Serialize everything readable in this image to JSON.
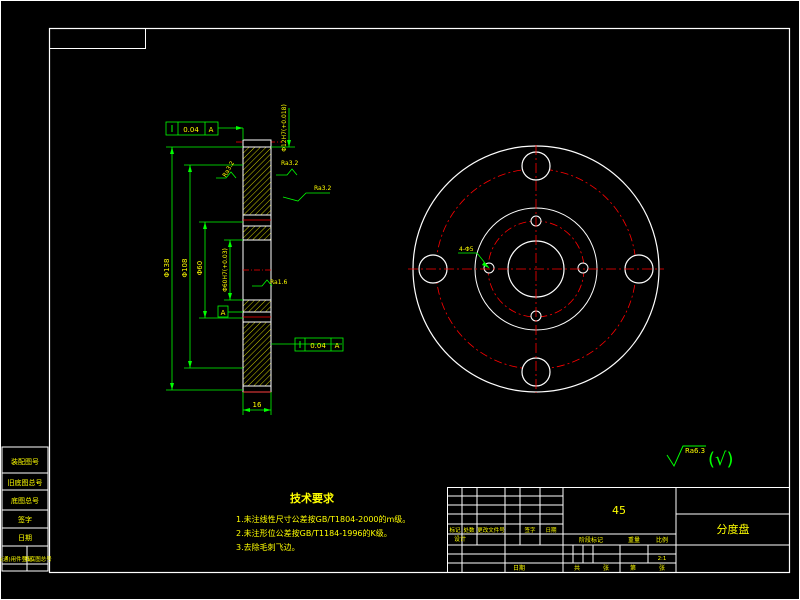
{
  "drawing": {
    "section_view": {
      "dim_outer_dia": "Φ138",
      "dim_mid_dia": "Φ108",
      "dim_inner_dia": "Φ60",
      "dim_bore_tol": "Φ60H7(+0.03)",
      "dim_top_tol": "Φ12H7(+0.018)",
      "dim_width": "16",
      "gdt_top_value": "0.04",
      "gdt_top_datum": "A",
      "gdt_bottom_value": "0.04",
      "gdt_bottom_datum": "A",
      "datum_label": "A",
      "rough_top_left": "Ra3.2",
      "rough_top_right": "Ra3.2",
      "rough_face": "Ra3.2",
      "rough_mid": "Ra1.6"
    },
    "front_view": {
      "hole_label": "4-Φ5"
    },
    "general_roughness": {
      "value": "Ra6.3",
      "suffix": "(√)"
    },
    "tech_requirements": {
      "title": "技术要求",
      "items": [
        "1.未注线性尺寸公差按GB/T1804-2000的m级。",
        "2.未注形位公差按GB/T1184-1996的K级。",
        "3.去除毛刺飞边。"
      ]
    },
    "left_strip": [
      "装配图号",
      "旧底图总号",
      "底图总号",
      "签字",
      "日期"
    ],
    "left_strip_bottom": [
      "借(通)用件登记",
      "旧底图总号"
    ],
    "title_block": {
      "material": "45",
      "part_name": "分度盘",
      "scale": "2:1",
      "row_labels": [
        "标记",
        "处数",
        "更改文件号",
        "签字",
        "日期"
      ],
      "row_designer": "设计",
      "stage_labels": [
        "阶段标记",
        "重量",
        "比例"
      ],
      "bottom_labels": [
        "共",
        "张",
        "第",
        "张"
      ],
      "date_label": "日期"
    }
  },
  "colors": {
    "frame": "#ffffff",
    "geometry": "#ffffff",
    "dimension": "#00ff00",
    "center_line": "#ff0000",
    "title_text": "#ffff00",
    "hatch": "#ffff00"
  }
}
